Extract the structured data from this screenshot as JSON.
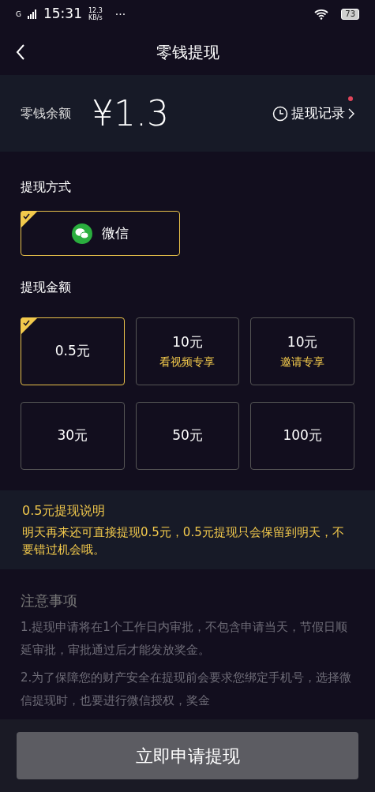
{
  "status_bar": {
    "time": "15:31",
    "speed": "12.3",
    "speed_unit": "KB/s",
    "dots": "···",
    "battery": "73",
    "network": "G"
  },
  "header": {
    "title": "零钱提现"
  },
  "balance": {
    "label": "零钱余额",
    "amount": "¥1.3",
    "history_link": "提现记录",
    "history_badge": true
  },
  "method_section": {
    "title": "提现方式",
    "options": [
      {
        "label": "微信",
        "selected": true
      }
    ]
  },
  "amount_section": {
    "title": "提现金额",
    "options": [
      {
        "label": "0.5元",
        "selected": true
      },
      {
        "label": "10元",
        "subtitle": "看视频专享",
        "selected": false
      },
      {
        "label": "10元",
        "subtitle": "邀请专享",
        "selected": false
      },
      {
        "label": "30元",
        "selected": false
      },
      {
        "label": "50元",
        "selected": false
      },
      {
        "label": "100元",
        "selected": false
      }
    ]
  },
  "explanation": {
    "title": "0.5元提现说明",
    "text": "明天再来还可直接提现0.5元，0.5元提现只会保留到明天，不要错过机会哦。"
  },
  "notes": {
    "title": "注意事项",
    "items": [
      "1.提现申请将在1个工作日内审批，不包含申请当天，节假日顺延审批，审批通过后才能发放奖金。",
      "2.为了保障您的财产安全在提现前会要求您绑定手机号，选择微信提现时，也要进行微信授权，奖金"
    ]
  },
  "submit_button": "立即申请提现"
}
